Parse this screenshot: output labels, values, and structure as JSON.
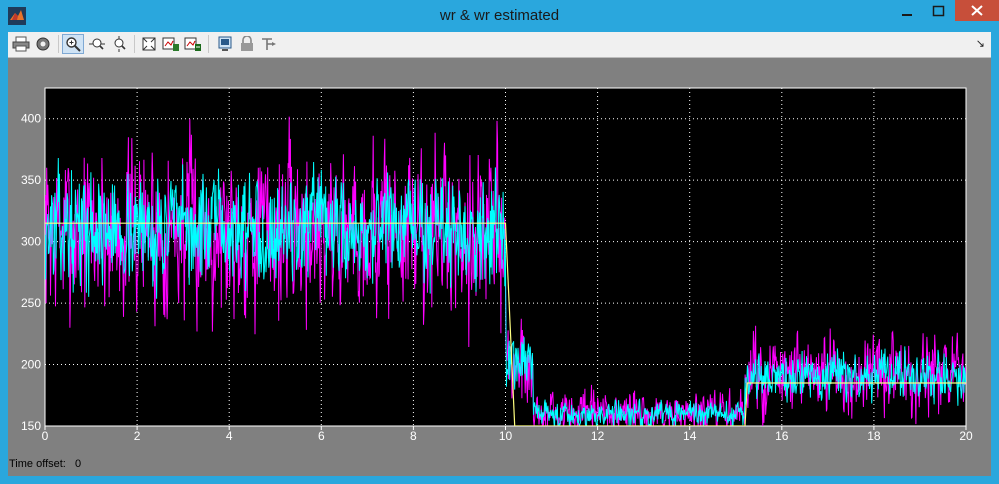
{
  "window": {
    "title": "wr & wr estimated"
  },
  "toolbar": {
    "buttons": [
      {
        "icon": "print-icon"
      },
      {
        "icon": "parameters-icon"
      },
      {
        "icon": "zoom-in-icon"
      },
      {
        "icon": "zoom-x-icon"
      },
      {
        "icon": "zoom-y-icon"
      },
      {
        "icon": "autoscale-icon"
      },
      {
        "icon": "save-axes-icon"
      },
      {
        "icon": "restore-axes-icon"
      },
      {
        "icon": "float-scope-icon"
      },
      {
        "icon": "lock-axes-icon"
      },
      {
        "icon": "signal-selection-icon"
      }
    ]
  },
  "status": {
    "time_offset_label": "Time offset:",
    "time_offset_value": "0"
  },
  "colors": {
    "background": "#000000",
    "grid": "#ffffff",
    "series_measured": "#ff00ff",
    "series_estimated": "#00ffff",
    "series_reference": "#ffff80",
    "figure_bg": "#808080"
  },
  "chart_data": {
    "type": "line",
    "xlim": [
      0,
      20
    ],
    "ylim": [
      150,
      425
    ],
    "grid": true,
    "xticks": [
      0,
      2,
      4,
      6,
      8,
      10,
      12,
      14,
      16,
      18,
      20
    ],
    "yticks": [
      150,
      200,
      250,
      300,
      350,
      400
    ],
    "reference": {
      "x": [
        0,
        10,
        10.2,
        15.2,
        15.25,
        20
      ],
      "y": [
        315,
        315,
        150,
        150,
        185,
        185
      ]
    },
    "segments": [
      {
        "t0": 0,
        "t1": 10,
        "mean": 310,
        "spread": 55
      },
      {
        "t0": 10,
        "t1": 10.6,
        "mean": 200,
        "spread": 30
      },
      {
        "t0": 10.6,
        "t1": 15.2,
        "mean": 160,
        "spread": 14
      },
      {
        "t0": 15.2,
        "t1": 20,
        "mean": 190,
        "spread": 25
      }
    ],
    "series": [
      {
        "color_key": "series_measured",
        "noise_scale": 1.6,
        "seed": 7
      },
      {
        "color_key": "series_estimated",
        "noise_scale": 1.0,
        "seed": 13
      }
    ]
  }
}
